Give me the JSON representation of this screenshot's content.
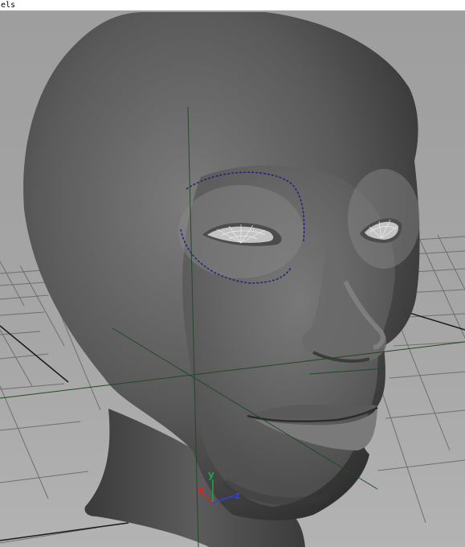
{
  "menubar": {
    "label": "els"
  },
  "axis_gizmo": {
    "x_label": "x",
    "y_label": "y",
    "z_label": "z"
  },
  "colors": {
    "axis_x": "#e02020",
    "axis_y": "#17a84a",
    "axis_z": "#3040e0",
    "axis_guide": "#1f4a2a",
    "eye_curve": "#222277",
    "mesh_dark": "#2c2c2c",
    "mesh_light": "#7d7d7d"
  },
  "icons": {
    "axis_gizmo": "xyz-axis-icon"
  }
}
